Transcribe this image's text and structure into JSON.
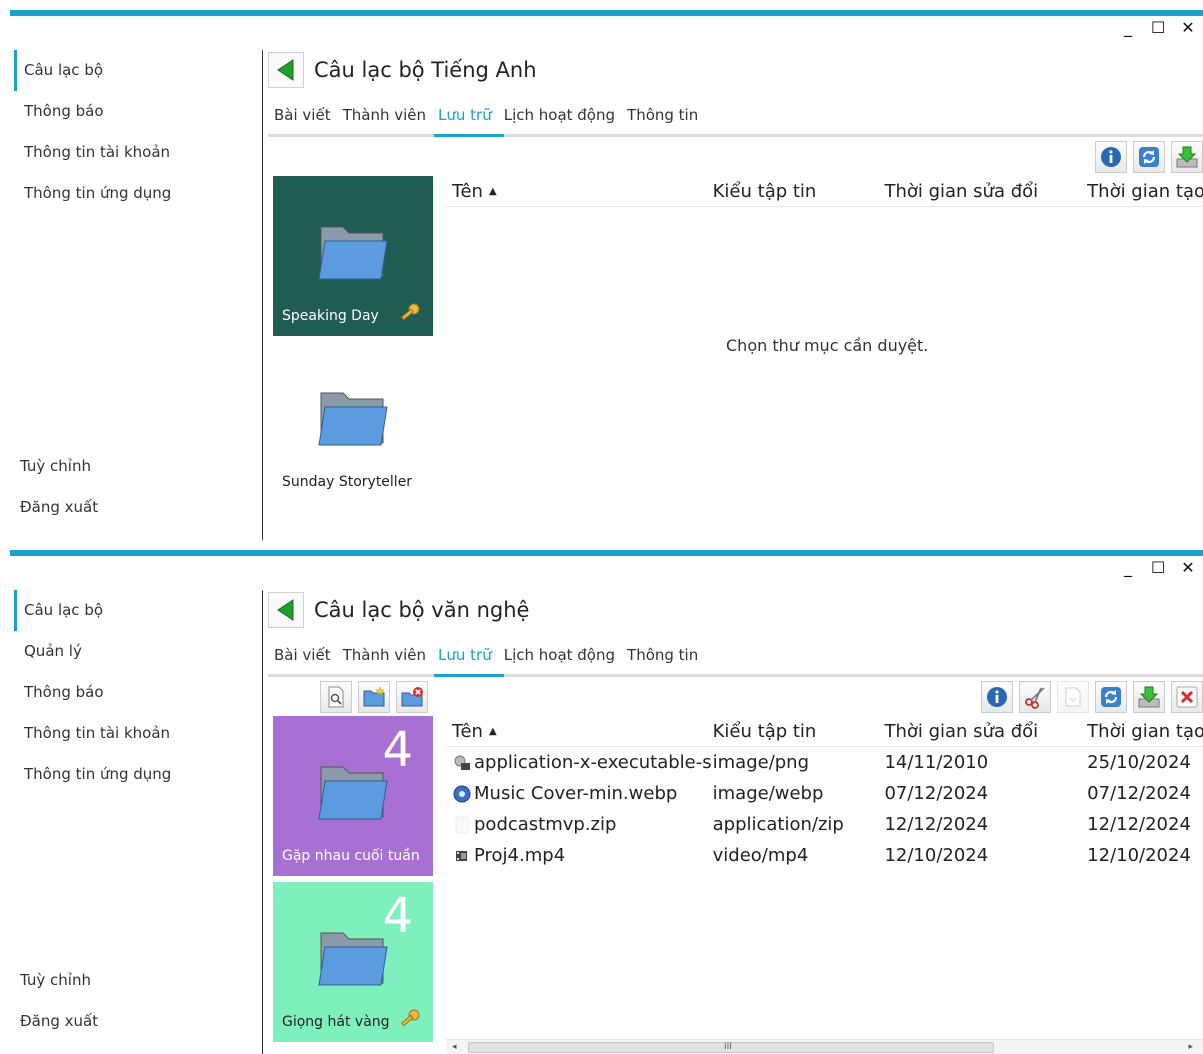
{
  "window1": {
    "controls": {
      "minimize": "_",
      "maximize": "☐",
      "close": "✕"
    },
    "sidebar": {
      "items": [
        {
          "label": "Câu lạc bộ",
          "active": true
        },
        {
          "label": "Thông báo"
        },
        {
          "label": "Thông tin tài khoản"
        },
        {
          "label": "Thông tin ứng dụng"
        }
      ],
      "bottom": [
        {
          "label": "Tuỳ chỉnh"
        },
        {
          "label": "Đăng xuất"
        }
      ]
    },
    "title": "Câu lạc bộ Tiếng Anh",
    "tabs": [
      {
        "label": "Bài viết"
      },
      {
        "label": "Thành viên"
      },
      {
        "label": "Lưu trữ",
        "active": true
      },
      {
        "label": "Lịch hoạt động"
      },
      {
        "label": "Thông tin"
      }
    ],
    "folders": [
      {
        "name": "Speaking Day",
        "bg": "#1f5c52",
        "text_color": "#ffffff",
        "locked": true
      },
      {
        "name": "Sunday Storyteller",
        "bg": "#ffffff",
        "text_color": "#222222",
        "locked": false
      }
    ],
    "columns": {
      "name": "Tên",
      "type": "Kiểu tập tin",
      "modified": "Thời gian sửa đổi",
      "time": "Thời gian tạo"
    },
    "empty_message": "Chọn thư mục cần duyệt."
  },
  "window2": {
    "controls": {
      "minimize": "_",
      "maximize": "☐",
      "close": "✕"
    },
    "sidebar": {
      "items": [
        {
          "label": "Câu lạc bộ",
          "active": true
        },
        {
          "label": "Quản lý"
        },
        {
          "label": "Thông báo"
        },
        {
          "label": "Thông tin tài khoản"
        },
        {
          "label": "Thông tin ứng dụng"
        }
      ],
      "bottom": [
        {
          "label": "Tuỳ chỉnh"
        },
        {
          "label": "Đăng xuất"
        }
      ]
    },
    "title": "Câu lạc bộ văn nghệ",
    "tabs": [
      {
        "label": "Bài viết"
      },
      {
        "label": "Thành viên"
      },
      {
        "label": "Lưu trữ",
        "active": true
      },
      {
        "label": "Lịch hoạt động"
      },
      {
        "label": "Thông tin"
      }
    ],
    "folders": [
      {
        "name": "Gặp nhau cuối tuần",
        "count": "4",
        "bg": "#a970d4",
        "text_color": "#ffffff",
        "locked": false
      },
      {
        "name": "Giọng hát vàng",
        "count": "4",
        "bg": "#7ef0bd",
        "text_color": "#222222",
        "locked": true
      }
    ],
    "columns": {
      "name": "Tên",
      "type": "Kiểu tập tin",
      "modified": "Thời gian sửa đổi",
      "time": "Thời gian tạo"
    },
    "files": [
      {
        "name": "application-x-executable-s...",
        "type": "image/png",
        "modified": "14/11/2010",
        "created": "25/10/2024",
        "icon": "executable-icon"
      },
      {
        "name": "Music Cover-min.webp",
        "type": "image/webp",
        "modified": "07/12/2024",
        "created": "07/12/2024",
        "icon": "webp-icon"
      },
      {
        "name": "podcastmvp.zip",
        "type": "application/zip",
        "modified": "12/12/2024",
        "created": "12/12/2024",
        "icon": "zip-icon"
      },
      {
        "name": "Proj4.mp4",
        "type": "video/mp4",
        "modified": "12/10/2024",
        "created": "12/10/2024",
        "icon": "video-icon"
      }
    ],
    "scrollbar": {
      "left": "◂",
      "right": "▸",
      "grip": "III"
    }
  }
}
